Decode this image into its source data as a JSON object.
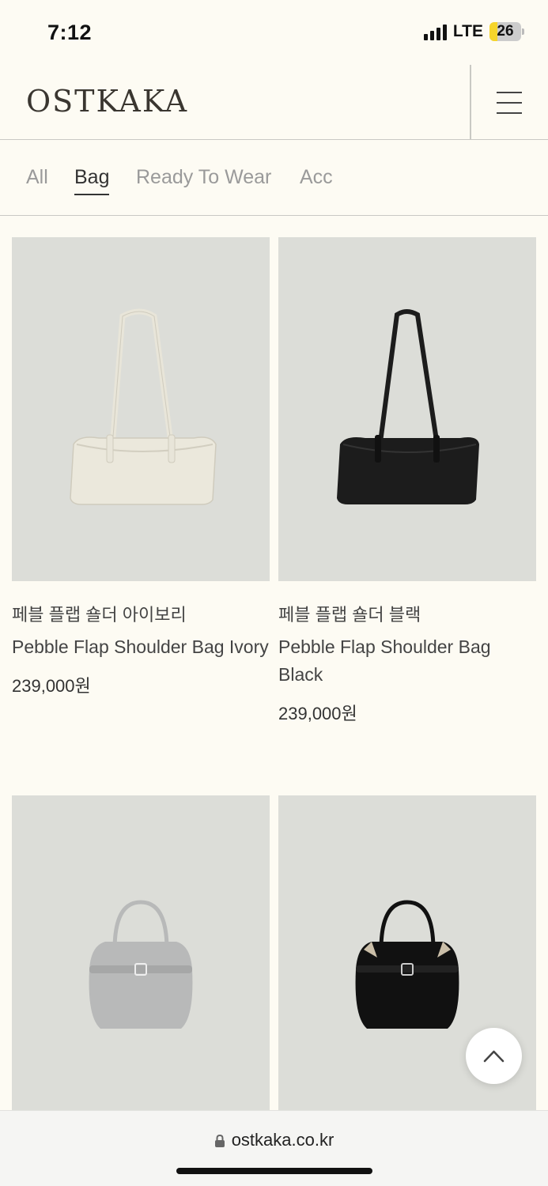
{
  "status_bar": {
    "time": "7:12",
    "network": "LTE",
    "battery": "26",
    "battery_level": 0.26
  },
  "header": {
    "logo": "OSTKAKA"
  },
  "tabs": [
    {
      "label": "All",
      "active": false
    },
    {
      "label": "Bag",
      "active": true
    },
    {
      "label": "Ready To Wear",
      "active": false
    },
    {
      "label": "Acc",
      "active": false
    }
  ],
  "products": [
    {
      "name_ko": "페블 플랩 숄더 아이보리",
      "name_en": "Pebble Flap Shoulder Bag Ivory",
      "price": "239,000원",
      "bag_color": "#ebe8dc"
    },
    {
      "name_ko": "페블 플랩 숄더 블랙",
      "name_en": "Pebble Flap Shoulder Bag Black",
      "price": "239,000원",
      "bag_color": "#1c1c1c"
    },
    {
      "bag_color": "#b8b9b9"
    },
    {
      "bag_color": "#111111"
    }
  ],
  "url_bar": {
    "url": "ostkaka.co.kr"
  },
  "colors": {
    "background": "#fdfbf3",
    "image_bg": "#dcddd8",
    "tab_inactive": "#9a9a9a"
  }
}
